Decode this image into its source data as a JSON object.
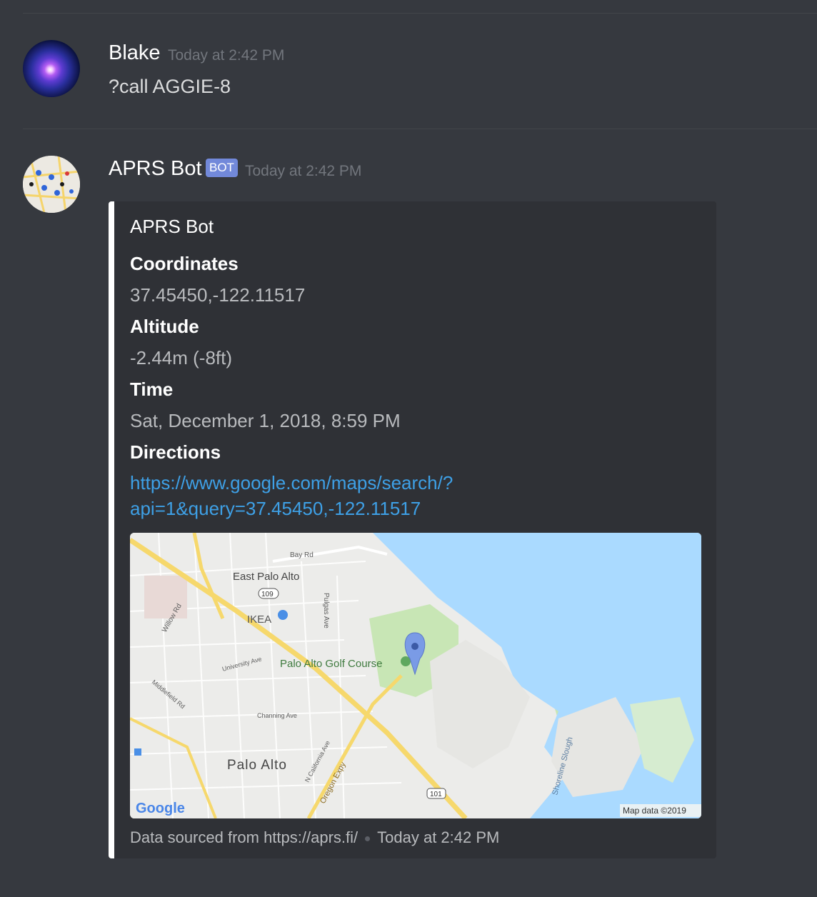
{
  "messages": [
    {
      "author": "Blake",
      "timestamp": "Today at 2:42 PM",
      "content": "?call AGGIE-8"
    },
    {
      "author": "APRS Bot",
      "badge": "BOT",
      "timestamp": "Today at 2:42 PM",
      "embed": {
        "title": "APRS Bot",
        "fields": [
          {
            "name": "Coordinates",
            "value": "37.45450,-122.11517"
          },
          {
            "name": "Altitude",
            "value": "-2.44m (-8ft)"
          },
          {
            "name": "Time",
            "value": "Sat, December 1, 2018, 8:59 PM"
          },
          {
            "name": "Directions",
            "value_line1": "https://www.google.com/maps/search/?",
            "value_line2": "api=1&query=37.45450,-122.11517"
          }
        ],
        "map_labels": {
          "bay_rd": "Bay Rd",
          "east_palo_alto": "East Palo Alto",
          "route_109": "109",
          "ikea": "IKEA",
          "pulgas_ave": "Pulgas Ave",
          "willow_rd": "Willow Rd",
          "university_ave": "University Ave",
          "golf_course": "Palo Alto Golf Course",
          "middlefield_rd": "Middlefield Rd",
          "channing_ave": "Channing Ave",
          "palo_alto": "Palo Alto",
          "california_ave": "N California Ave",
          "oregon_expy": "Oregon Expy",
          "route_101": "101",
          "shoreline_slough": "Shoreline Slough",
          "google": "Google",
          "map_data": "Map data ©2019"
        },
        "footer_text": "Data sourced from https://aprs.fi/",
        "footer_timestamp": "Today at 2:42 PM"
      }
    }
  ],
  "colors": {
    "background": "#36393f",
    "embed_bg": "#2f3136",
    "link": "#3ea0e6",
    "bot_badge": "#7289da",
    "water": "#aadaff",
    "marker": "#6f94e8"
  }
}
